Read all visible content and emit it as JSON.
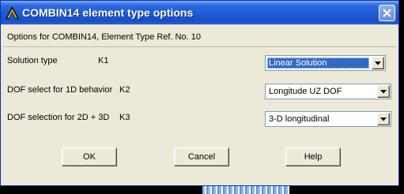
{
  "window": {
    "title": "COMBIN14 element type options"
  },
  "dialog": {
    "info_line": "Options for COMBIN14, Element Type Ref. No. 10",
    "options": [
      {
        "label": "Solution type",
        "key": "K1",
        "value": "Linear Solution"
      },
      {
        "label": "DOF select for 1D behavior",
        "key": "K2",
        "value": "Longitude UZ DOF"
      },
      {
        "label": "DOF selection for 2D + 3D",
        "key": "K3",
        "value": "3-D longitudinal"
      }
    ],
    "buttons": {
      "ok": "OK",
      "cancel": "Cancel",
      "help": "Help"
    }
  },
  "colors": {
    "titlebar": "#1e5ad6",
    "dialog_bg": "#ece9d8",
    "selection": "#316ac5"
  },
  "icons": {
    "app": "ansys-logo-icon",
    "close": "close-icon",
    "dropdown": "chevron-down-icon"
  }
}
